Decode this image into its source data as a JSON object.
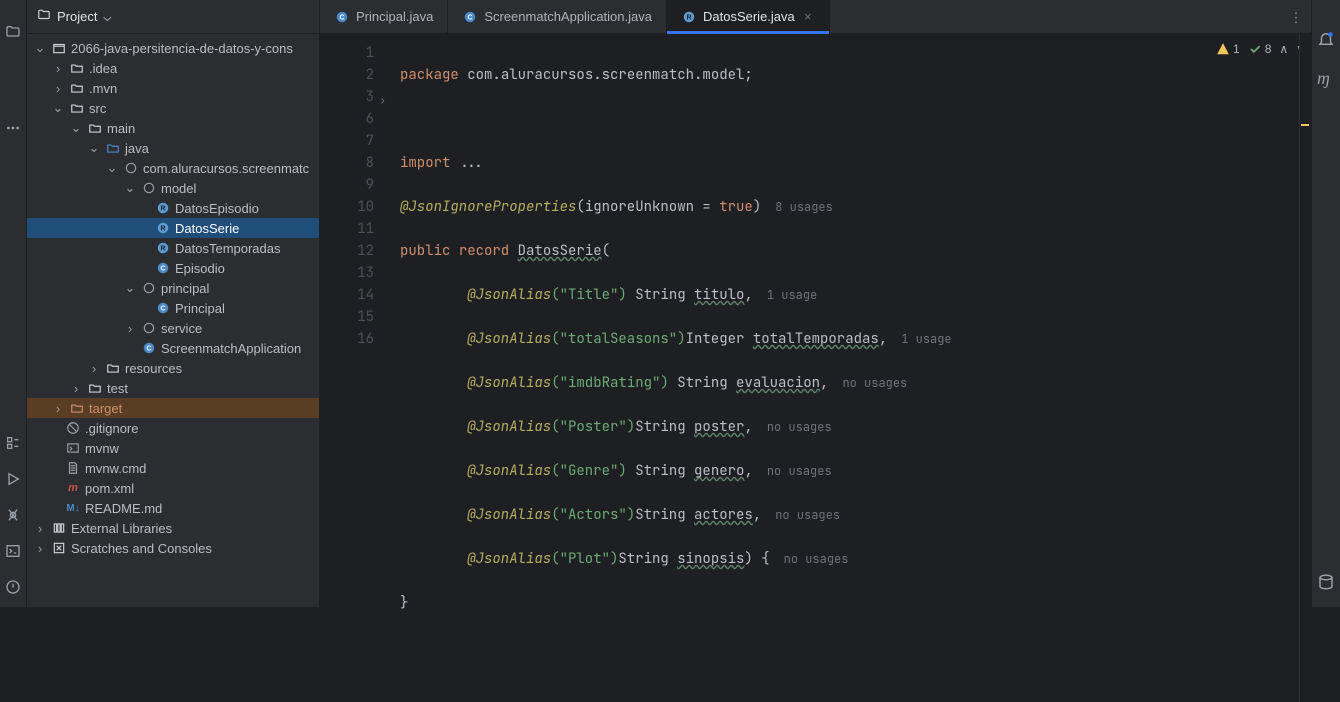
{
  "project": {
    "title": "Project",
    "tree": {
      "root": "2066-java-persitencia-de-datos-y-cons",
      "idea": ".idea",
      "mvn": ".mvn",
      "src": "src",
      "main": "main",
      "java": "java",
      "pkg": "com.aluracursos.screenmatc",
      "model": "model",
      "file_de": "DatosEpisodio",
      "file_ds": "DatosSerie",
      "file_dt": "DatosTemporadas",
      "file_ep": "Episodio",
      "principal": "principal",
      "file_principal": "Principal",
      "service": "service",
      "file_app": "ScreenmatchApplication",
      "resources": "resources",
      "test": "test",
      "target": "target",
      "gitignore": ".gitignore",
      "mvnw": "mvnw",
      "mvnwcmd": "mvnw.cmd",
      "pom": "pom.xml",
      "readme": "README.md",
      "extlib": "External Libraries",
      "scratch": "Scratches and Consoles"
    }
  },
  "tabs": {
    "t0": "Principal.java",
    "t1": "ScreenmatchApplication.java",
    "t2": "DatosSerie.java"
  },
  "warnings": {
    "warn_count": "1",
    "ok_count": "8"
  },
  "code": {
    "l1": {
      "package": "package",
      "pkg": "com.aluracursos.screenmatch.model",
      "semi": ";"
    },
    "l3": {
      "imp": "import",
      "dots": "..."
    },
    "l6": {
      "anno": "@JsonIgnoreProperties",
      "p1": "(",
      "arg": "ignoreUnknown",
      "eq": " = ",
      "val": "true",
      "p2": ")",
      "hint": "8 usages"
    },
    "l7": {
      "pub": "public",
      "rec": "record",
      "name": "DatosSerie",
      "op": "("
    },
    "l8": {
      "anno": "@JsonAlias",
      "p": "(\"Title\")",
      "sp": " ",
      "type": "String ",
      "fld": "titulo",
      "comma": ",",
      "hint": "1 usage"
    },
    "l9": {
      "anno": "@JsonAlias",
      "p": "(\"totalSeasons\")",
      "type": "Integer ",
      "fld": "totalTemporadas",
      "comma": ",",
      "hint": "1 usage"
    },
    "l10": {
      "anno": "@JsonAlias",
      "p": "(\"imdbRating\")",
      "sp": " ",
      "type": "String ",
      "fld": "evaluacion",
      "comma": ",",
      "hint": "no usages"
    },
    "l11": {
      "anno": "@JsonAlias",
      "p": "(\"Poster\")",
      "type": "String ",
      "fld": "poster",
      "comma": ",",
      "hint": "no usages"
    },
    "l12": {
      "anno": "@JsonAlias",
      "p": "(\"Genre\")",
      "sp": " ",
      "type": "String ",
      "fld": "genero",
      "comma": ",",
      "hint": "no usages"
    },
    "l13": {
      "anno": "@JsonAlias",
      "p": "(\"Actors\")",
      "type": "String ",
      "fld": "actores",
      "comma": ",",
      "hint": "no usages"
    },
    "l14": {
      "anno": "@JsonAlias",
      "p": "(\"Plot\")",
      "type": "String ",
      "fld": "sinopsis",
      "end": ") {",
      "hint": "no usages"
    },
    "l15": {
      "brace": "}"
    }
  },
  "gutter": [
    "1",
    "2",
    "3",
    "6",
    "7",
    "8",
    "9",
    "10",
    "11",
    "12",
    "13",
    "14",
    "15",
    "16"
  ]
}
